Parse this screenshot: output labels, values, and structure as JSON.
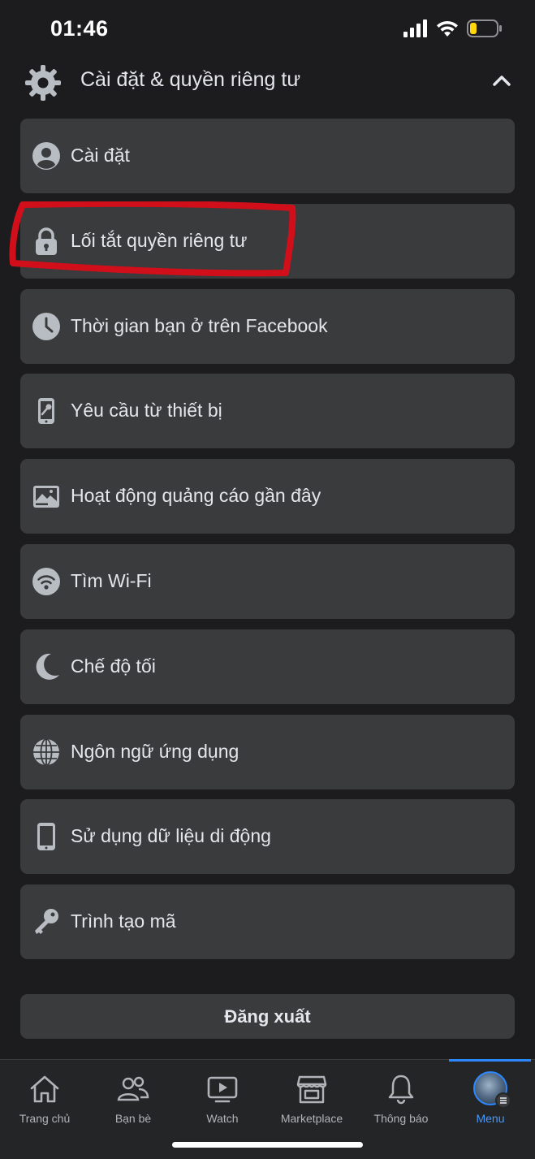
{
  "status_bar": {
    "time": "01:46",
    "signal_icon": "cellular-signal-icon",
    "wifi_icon": "wifi-icon",
    "battery_icon": "battery-low-icon",
    "battery_color": "#ffd60a"
  },
  "section": {
    "title": "Cài đặt & quyền riêng tư",
    "icon": "gear-icon",
    "expand_icon": "chevron-up-icon"
  },
  "items": [
    {
      "label": "Cài đặt",
      "icon": "user-circle-icon"
    },
    {
      "label": "Lối tắt quyền riêng tư",
      "icon": "lock-icon",
      "highlighted": true
    },
    {
      "label": "Thời gian bạn ở trên Facebook",
      "icon": "clock-icon"
    },
    {
      "label": "Yêu cầu từ thiết bị",
      "icon": "phone-key-icon"
    },
    {
      "label": "Hoạt động quảng cáo gần đây",
      "icon": "ad-image-icon"
    },
    {
      "label": "Tìm Wi-Fi",
      "icon": "wifi-icon"
    },
    {
      "label": "Chế độ tối",
      "icon": "moon-icon"
    },
    {
      "label": "Ngôn ngữ ứng dụng",
      "icon": "globe-icon"
    },
    {
      "label": "Sử dụng dữ liệu di động",
      "icon": "mobile-phone-icon"
    },
    {
      "label": "Trình tạo mã",
      "icon": "key-icon"
    }
  ],
  "logout_label": "Đăng xuất",
  "tabs": [
    {
      "label": "Trang chủ",
      "icon": "home-icon"
    },
    {
      "label": "Bạn bè",
      "icon": "friends-icon"
    },
    {
      "label": "Watch",
      "icon": "watch-video-icon"
    },
    {
      "label": "Marketplace",
      "icon": "marketplace-store-icon"
    },
    {
      "label": "Thông báo",
      "icon": "bell-icon"
    },
    {
      "label": "Menu",
      "icon": "avatar",
      "active": true
    }
  ],
  "colors": {
    "background": "#1c1c1e",
    "card": "#3a3b3c",
    "text": "#e4e6eb",
    "active_tab": "#2d88ff",
    "highlight_annotation": "#d10f1a"
  }
}
